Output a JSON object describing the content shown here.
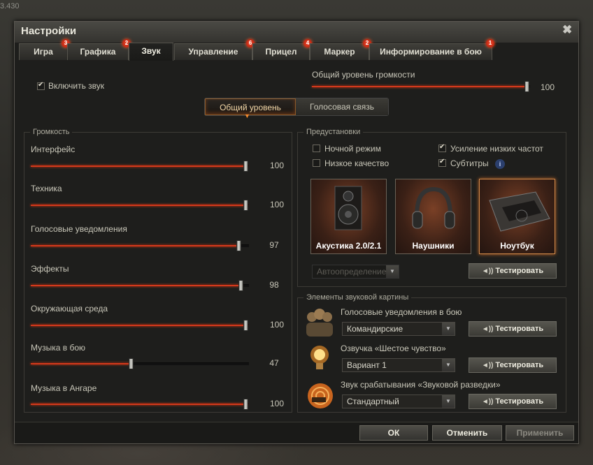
{
  "version_text": "3.430",
  "window": {
    "title": "Настройки"
  },
  "tabs": [
    {
      "label": "Игра",
      "badge": "3"
    },
    {
      "label": "Графика",
      "badge": "2"
    },
    {
      "label": "Звук",
      "badge": ""
    },
    {
      "label": "Управление",
      "badge": "6"
    },
    {
      "label": "Прицел",
      "badge": "4"
    },
    {
      "label": "Маркер",
      "badge": "2"
    },
    {
      "label": "Информирование в бою",
      "badge": "1"
    }
  ],
  "enable_sound": {
    "label": "Включить звук",
    "checked": true
  },
  "master": {
    "label": "Общий уровень громкости",
    "value": "100"
  },
  "segment": {
    "active": "Общий уровень",
    "other": "Голосовая связь"
  },
  "volume": {
    "group": "Громкость",
    "sliders": [
      {
        "label": "Интерфейс",
        "value": "100"
      },
      {
        "label": "Техника",
        "value": "100"
      },
      {
        "label": "Голосовые уведомления",
        "value": "97"
      },
      {
        "label": "Эффекты",
        "value": "98"
      },
      {
        "label": "Окружающая среда",
        "value": "100"
      },
      {
        "label": "Музыка в бою",
        "value": "47"
      },
      {
        "label": "Музыка в Ангаре",
        "value": "100"
      }
    ]
  },
  "presets": {
    "group": "Предустановки",
    "night": "Ночной режим",
    "low": "Низкое качество",
    "bass": "Усиление низких частот",
    "subs": "Субтитры",
    "cards": [
      "Акустика 2.0/2.1",
      "Наушники",
      "Ноутбук"
    ],
    "auto": "Автоопределение",
    "test": "Тестировать"
  },
  "elements": {
    "group": "Элементы звуковой картины",
    "items": [
      {
        "label": "Голосовые уведомления в бою",
        "value": "Командирские",
        "test": "Тестировать"
      },
      {
        "label": "Озвучка «Шестое чувство»",
        "value": "Вариант 1",
        "test": "Тестировать"
      },
      {
        "label": "Звук срабатывания «Звуковой разведки»",
        "value": "Стандартный",
        "test": "Тестировать"
      }
    ]
  },
  "footer": {
    "ok": "ОК",
    "cancel": "Отменить",
    "apply": "Применить"
  }
}
